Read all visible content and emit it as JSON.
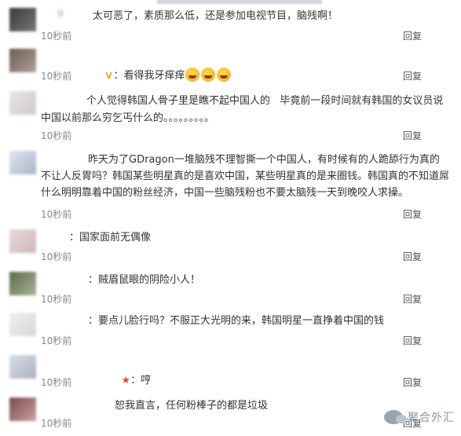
{
  "comments": [
    {
      "user": "9",
      "text": "太可恶了，素质那么低，还是参加电视节目，脑残啊！",
      "time": "10秒前",
      "reply": "回复"
    },
    {
      "user": "",
      "text": "看得我牙痒痒",
      "time": "10秒前",
      "reply": "回复"
    },
    {
      "user": "",
      "text": "个人觉得韩国人骨子里是瞧不起中国人的   毕竟前一段时间就有韩国的女议员说中国以前那么穷乞丐什么的。。。。。。。。。",
      "time": "10秒前",
      "reply": "回复"
    },
    {
      "user": "",
      "text": "昨天为了GDragon一堆脑残不理智撕一个中国人，有时候有的人跪舔行为真的不让人反胃吗？韩国某些明星真的是喜欢中国，某些明星真的是来圈钱。韩国真的不知道屌什么明明靠着中国的粉丝经济，中国一些脑残粉也不要太脑残一天到晚咬人求操。",
      "time": "10秒前",
      "reply": "回复"
    },
    {
      "user": "",
      "text": "国家面前无偶像",
      "time": "10秒前",
      "reply": "回复"
    },
    {
      "user": "",
      "text": "贼眉鼠眼的阴险小人！",
      "time": "10秒前",
      "reply": "回复"
    },
    {
      "user": "",
      "text": "要点儿脸行吗？不服正大光明的来，韩国明星一直挣着中国的钱",
      "time": "10秒前",
      "reply": "回复"
    },
    {
      "user": "",
      "text": "哼",
      "time": "10秒前",
      "reply": "回复"
    },
    {
      "user": "",
      "text": "恕我直言，任何粉棒子的都是垃圾",
      "time": "10秒前",
      "reply": "回复"
    }
  ],
  "watermark": {
    "text": "聚合外汇"
  }
}
